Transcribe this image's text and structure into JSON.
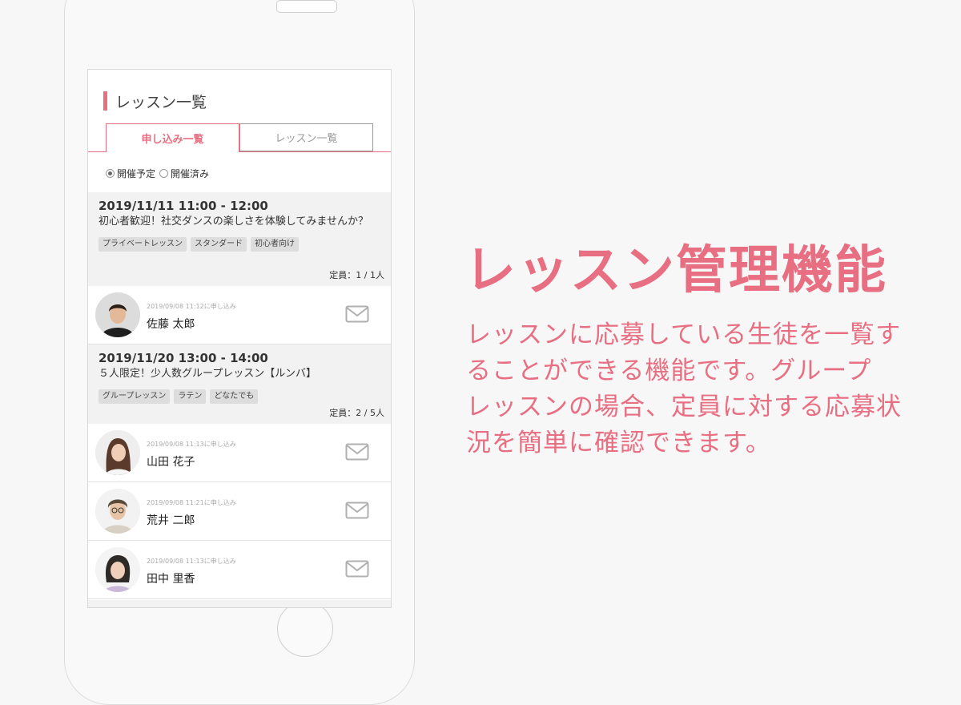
{
  "screen": {
    "title": "レッスン一覧",
    "tabs": [
      {
        "label": "申し込み一覧",
        "active": true
      },
      {
        "label": "レッスン一覧",
        "active": false
      }
    ],
    "filters": [
      {
        "label": "開催予定",
        "checked": true
      },
      {
        "label": "開催済み",
        "checked": false
      }
    ],
    "lessons": [
      {
        "datetime": "2019/11/11  11:00 - 12:00",
        "description": "初心者歓迎！社交ダンスの楽しさを体験してみませんか？",
        "tags": [
          "プライベートレッスン",
          "スタンダード",
          "初心者向け"
        ],
        "capacity": "定員：1 / 1人",
        "applicants": [
          {
            "applied_at": "2019/09/08 11:12に申し込み",
            "name": "佐藤 太郎",
            "avatar_icon": "person-avatar"
          }
        ]
      },
      {
        "datetime": "2019/11/20  13:00 - 14:00",
        "description": "５人限定！少人数グループレッスン【ルンバ】",
        "tags": [
          "グループレッスン",
          "ラテン",
          "どなたでも"
        ],
        "capacity": "定員：2 / 5人",
        "applicants": [
          {
            "applied_at": "2019/09/08 11:13に申し込み",
            "name": "山田 花子",
            "avatar_icon": "person-avatar"
          },
          {
            "applied_at": "2019/09/08 11:21に申し込み",
            "name": "荒井 二郎",
            "avatar_icon": "person-avatar"
          },
          {
            "applied_at": "2019/09/08 11:13に申し込み",
            "name": "田中 里香",
            "avatar_icon": "person-avatar"
          }
        ]
      }
    ]
  },
  "promo": {
    "headline": "レッスン管理機能",
    "lines": [
      "レッスンに応募している生徒を一覧す",
      "ることができる機能です。グループ",
      "レッスンの場合、定員に対する応募状",
      "況を簡単に確認できます。"
    ]
  },
  "colors": {
    "accent": "#e86e82",
    "background": "#f7f7f7",
    "card_bg": "#f2f2f2",
    "tag_bg": "#dddddd"
  },
  "icons": {
    "mail": "envelope-icon",
    "radio": "radio-icon"
  }
}
